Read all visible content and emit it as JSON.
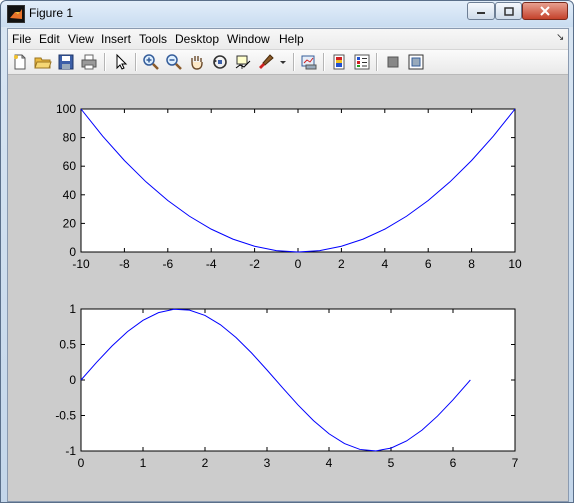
{
  "window": {
    "title": "Figure 1"
  },
  "menu": {
    "items": [
      "File",
      "Edit",
      "View",
      "Insert",
      "Tools",
      "Desktop",
      "Window",
      "Help"
    ]
  },
  "toolbar": {
    "buttons": [
      {
        "name": "new-figure-icon"
      },
      {
        "name": "open-file-icon"
      },
      {
        "name": "save-icon"
      },
      {
        "name": "print-icon"
      },
      {
        "name": "edit-plot-arrow-icon"
      },
      {
        "name": "zoom-in-icon"
      },
      {
        "name": "zoom-out-icon"
      },
      {
        "name": "pan-hand-icon"
      },
      {
        "name": "rotate-3d-icon"
      },
      {
        "name": "data-cursor-icon"
      },
      {
        "name": "brush-icon"
      },
      {
        "name": "brush-dropdown-icon"
      },
      {
        "name": "link-plot-icon"
      },
      {
        "name": "insert-colorbar-icon"
      },
      {
        "name": "insert-legend-icon"
      },
      {
        "name": "hide-plot-tools-icon"
      },
      {
        "name": "show-plot-tools-icon"
      }
    ]
  },
  "chart_data": [
    {
      "type": "line",
      "title": "",
      "xlabel": "",
      "ylabel": "",
      "function": "y = x^2",
      "xlim": [
        -10,
        10
      ],
      "ylim": [
        0,
        100
      ],
      "xticks": [
        "-10",
        "-8",
        "-6",
        "-4",
        "-2",
        "0",
        "2",
        "4",
        "6",
        "8",
        "10"
      ],
      "yticks": [
        "0",
        "20",
        "40",
        "60",
        "80",
        "100"
      ],
      "series": [
        {
          "color": "#0000ff",
          "x": [
            -10,
            -9,
            -8,
            -7,
            -6,
            -5,
            -4,
            -3,
            -2,
            -1,
            0,
            1,
            2,
            3,
            4,
            5,
            6,
            7,
            8,
            9,
            10
          ],
          "y": [
            100,
            81,
            64,
            49,
            36,
            25,
            16,
            9,
            4,
            1,
            0,
            1,
            4,
            9,
            16,
            25,
            36,
            49,
            64,
            81,
            100
          ]
        }
      ],
      "grid": false
    },
    {
      "type": "line",
      "title": "",
      "xlabel": "",
      "ylabel": "",
      "function": "y = sin(x)",
      "xlim": [
        0,
        7
      ],
      "ylim": [
        -1,
        1
      ],
      "xticks": [
        "0",
        "1",
        "2",
        "3",
        "4",
        "5",
        "6",
        "7"
      ],
      "yticks": [
        "-1",
        "-0.5",
        "0",
        "0.5",
        "1"
      ],
      "series": [
        {
          "color": "#0000ff",
          "x": [
            0,
            0.25,
            0.5,
            0.75,
            1,
            1.25,
            1.5,
            1.75,
            2,
            2.25,
            2.5,
            2.75,
            3,
            3.25,
            3.5,
            3.75,
            4,
            4.25,
            4.5,
            4.75,
            5,
            5.25,
            5.5,
            5.75,
            6,
            6.28
          ],
          "y": [
            0,
            0.247,
            0.479,
            0.682,
            0.841,
            0.949,
            0.997,
            0.984,
            0.909,
            0.778,
            0.598,
            0.382,
            0.141,
            -0.108,
            -0.351,
            -0.572,
            -0.757,
            -0.895,
            -0.978,
            -0.999,
            -0.959,
            -0.859,
            -0.706,
            -0.508,
            -0.279,
            0
          ]
        }
      ],
      "grid": false
    }
  ]
}
